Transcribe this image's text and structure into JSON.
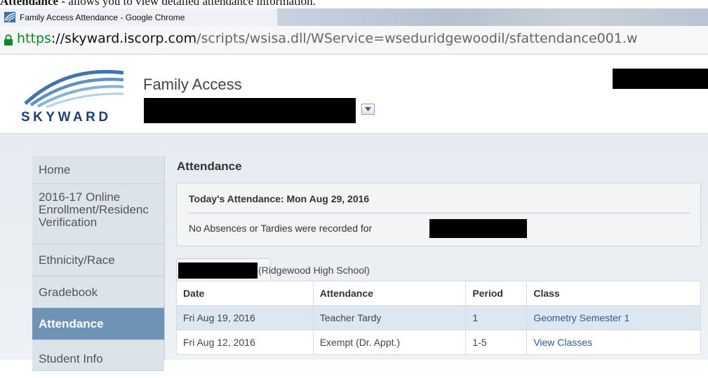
{
  "doc_caption": {
    "bold": "Attendance",
    "rest": " - allows you to view detailed attendance information."
  },
  "window": {
    "title": "Family Access Attendance - Google Chrome"
  },
  "address": {
    "scheme": "https",
    "domain": "://skyward.iscorp.com",
    "path": "/scripts/wsisa.dll/WService=wseduridgewoodil/sfattendance001.w"
  },
  "header": {
    "logo_text": "SKYWARD",
    "title": "Family Access"
  },
  "sidebar": {
    "items": [
      {
        "label": "Home"
      },
      {
        "label_lines": [
          "2016-17 Online",
          "Enrollment/Residenc",
          "Verification"
        ]
      },
      {
        "label": "Ethnicity/Race"
      },
      {
        "label": "Gradebook"
      },
      {
        "label": "Attendance"
      },
      {
        "label": "Student Info"
      }
    ]
  },
  "main": {
    "title": "Attendance",
    "today": {
      "heading": "Today's Attendance: Mon Aug 29, 2016",
      "message": "No Absences or Tardies were recorded for"
    },
    "school_tab": "(Ridgewood High School)",
    "table": {
      "columns": [
        "Date",
        "Attendance",
        "Period",
        "Class"
      ],
      "rows": [
        [
          "Fri Aug 19, 2016",
          "Teacher Tardy",
          "1",
          "Geometry Semester 1"
        ],
        [
          "Fri Aug 12, 2016",
          "Exempt (Dr. Appt.)",
          "1-5",
          "View Classes"
        ]
      ]
    }
  },
  "colors": {
    "accent": "#6f93b5",
    "link": "#2c5d95",
    "secure": "#0a8a23"
  }
}
